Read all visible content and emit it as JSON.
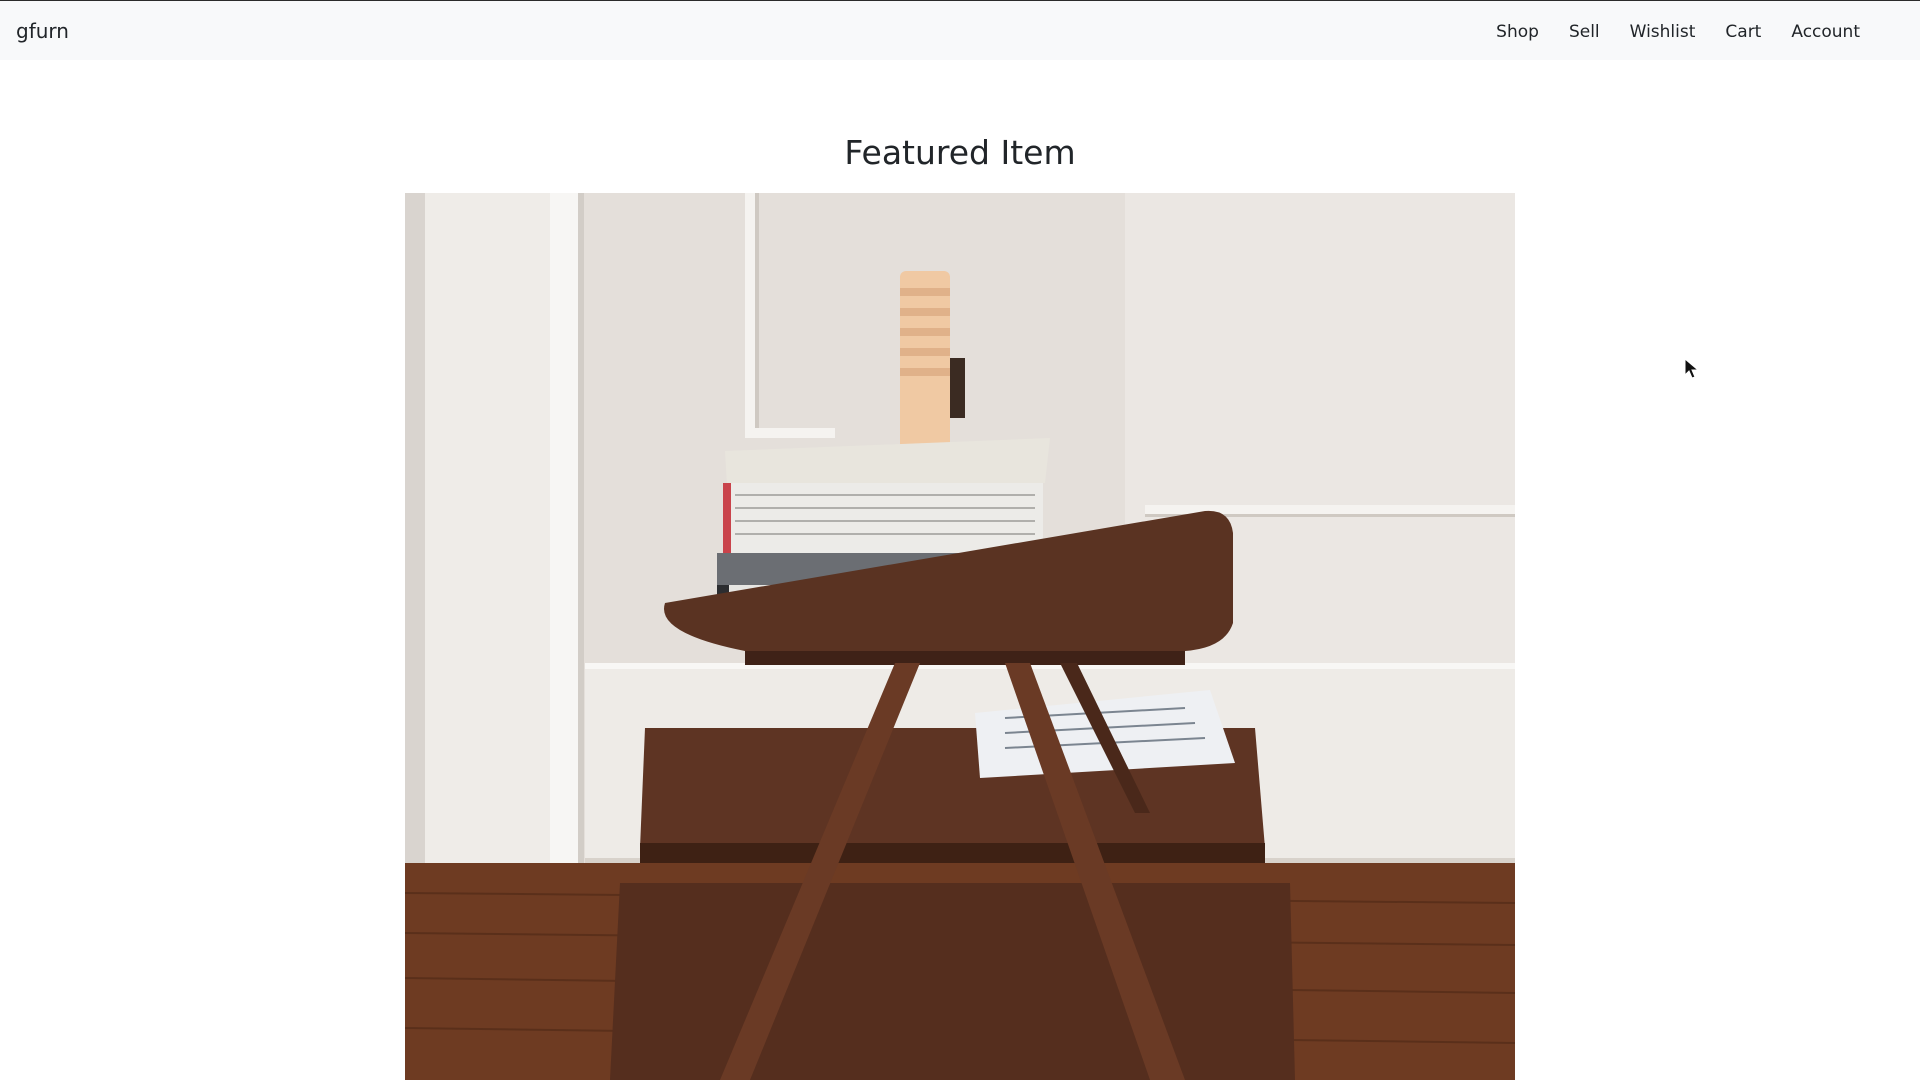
{
  "navbar": {
    "brand": "gfurn",
    "links": [
      {
        "label": "Shop"
      },
      {
        "label": "Sell"
      },
      {
        "label": "Wishlist"
      },
      {
        "label": "Cart"
      },
      {
        "label": "Account"
      }
    ]
  },
  "main": {
    "title": "Featured Item",
    "featured_image_icon": "side-table-photo"
  },
  "colors": {
    "navbar_bg": "#f8f9fa",
    "text": "#212529",
    "wall": "#e6e1dc",
    "wood": "#5a3525",
    "floor": "#6b3a22"
  }
}
